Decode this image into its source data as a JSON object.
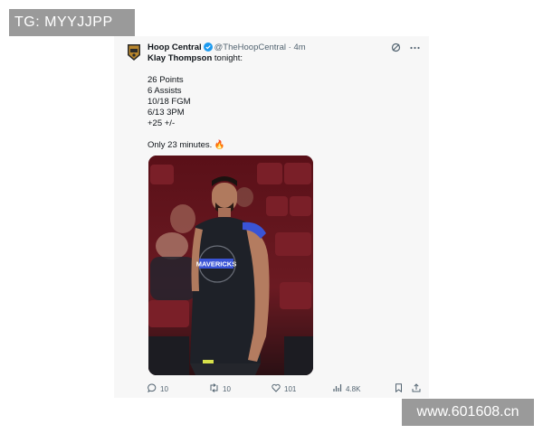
{
  "watermarks": {
    "top_left": "TG: MYYJJPP",
    "bottom_right": "www.601608.cn"
  },
  "tweet": {
    "author_name": "Hoop Central",
    "author_handle": "@TheHoopCentral",
    "separator": "·",
    "time": "4m",
    "intro_name": "Klay Thompson",
    "intro_rest": " tonight:",
    "stats": [
      "26 Points",
      "6 Assists",
      "10/18 FGM",
      "6/13 3PM",
      "+25 +/-"
    ],
    "note": "Only 23 minutes. 🔥",
    "photo_text": {
      "jersey": "MAVERICKS"
    }
  },
  "actions": {
    "replies": "10",
    "reposts": "10",
    "likes": "101",
    "views": "4.8K"
  },
  "icons": {
    "header": [
      "verified-badge-icon",
      "grok-icon",
      "more-icon"
    ],
    "actions": [
      "reply-icon",
      "retweet-icon",
      "like-icon",
      "views-icon",
      "bookmark-icon",
      "share-icon"
    ]
  },
  "colors": {
    "verified": "#1d9bf0",
    "jersey_accent": "#3a54d6",
    "court_seats": "#6b1a22"
  }
}
